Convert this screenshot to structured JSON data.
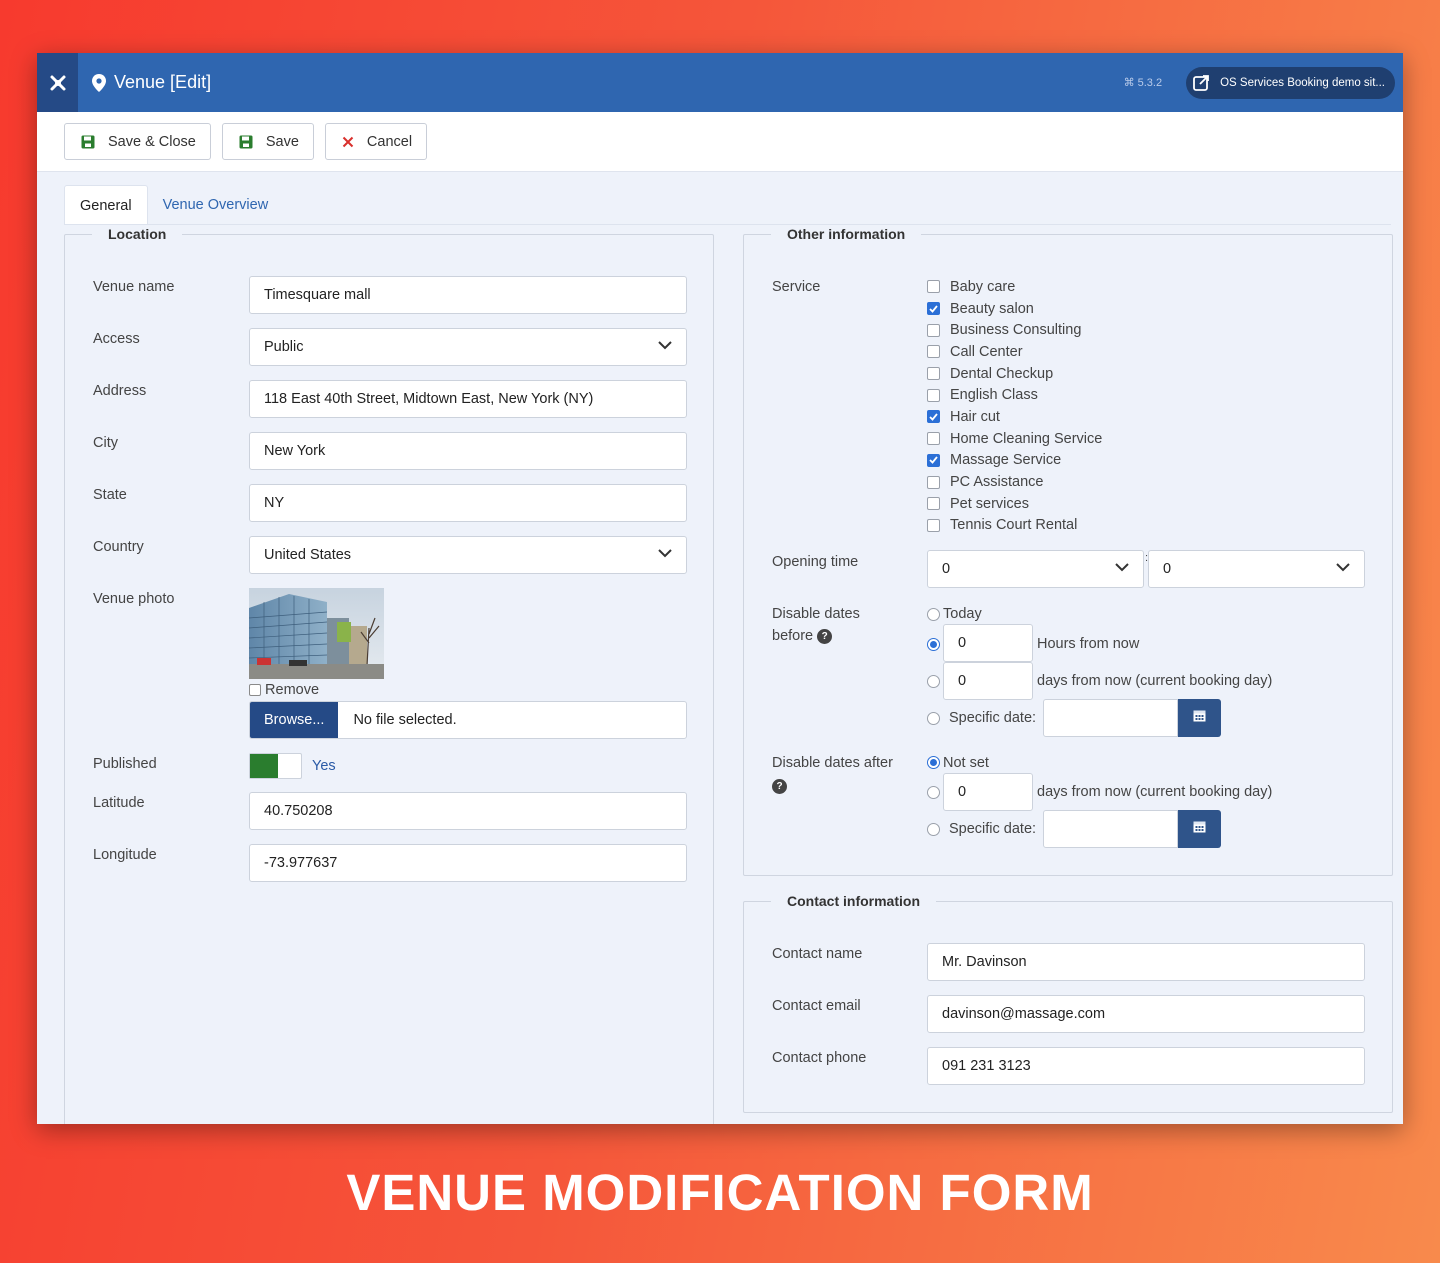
{
  "topbar": {
    "title": "Venue [Edit]",
    "version": "5.3.2",
    "site_link": "OS Services Booking demo sit..."
  },
  "toolbar": {
    "save_close": "Save & Close",
    "save": "Save",
    "cancel": "Cancel"
  },
  "tabs": [
    "General",
    "Venue Overview"
  ],
  "location": {
    "legend": "Location",
    "venue_name_label": "Venue name",
    "venue_name": "Timesquare mall",
    "access_label": "Access",
    "access": "Public",
    "address_label": "Address",
    "address": "118 East 40th Street, Midtown East, New York (NY)",
    "city_label": "City",
    "city": "New York",
    "state_label": "State",
    "state": "NY",
    "country_label": "Country",
    "country": "United States",
    "photo_label": "Venue photo",
    "remove_label": "Remove",
    "browse_label": "Browse...",
    "file_text": "No file selected.",
    "published_label": "Published",
    "published_value": "Yes",
    "latitude_label": "Latitude",
    "latitude": "40.750208",
    "longitude_label": "Longitude",
    "longitude": "-73.977637"
  },
  "other": {
    "legend": "Other information",
    "service_label": "Service",
    "services": [
      {
        "label": "Baby care",
        "checked": false
      },
      {
        "label": "Beauty salon",
        "checked": true
      },
      {
        "label": "Business Consulting",
        "checked": false
      },
      {
        "label": "Call Center",
        "checked": false
      },
      {
        "label": "Dental Checkup",
        "checked": false
      },
      {
        "label": "English Class",
        "checked": false
      },
      {
        "label": "Hair cut",
        "checked": true
      },
      {
        "label": "Home Cleaning Service",
        "checked": false
      },
      {
        "label": "Massage Service",
        "checked": true
      },
      {
        "label": "PC Assistance",
        "checked": false
      },
      {
        "label": "Pet services",
        "checked": false
      },
      {
        "label": "Tennis Court Rental",
        "checked": false
      }
    ],
    "opening_label": "Opening time",
    "opening_hour": "0",
    "opening_minute": "0",
    "opening_sep": ":",
    "disable_before_label_1": "Disable dates",
    "disable_before_label_2": "before",
    "today_label": "Today",
    "hours_value": "0",
    "hours_label": "Hours from now",
    "days_value": "0",
    "days_label": "days from now (current booking day)",
    "specific_label": "Specific date:",
    "disable_after_label": "Disable dates after",
    "not_set_label": "Not set",
    "after_days_value": "0",
    "after_days_label": "days from now (current booking day)",
    "after_specific_label": "Specific date:"
  },
  "contact": {
    "legend": "Contact information",
    "name_label": "Contact name",
    "name": "Mr. Davinson",
    "email_label": "Contact email",
    "email": "davinson@massage.com",
    "phone_label": "Contact phone",
    "phone": "091 231 3123"
  },
  "caption": "VENUE MODIFICATION FORM",
  "colors": {
    "header": "#2f66b0",
    "header_dark": "#254a86",
    "accent": "#2b6fd6",
    "toggle_on": "#2a7d2e",
    "save_icon": "#2a7d2e",
    "cancel_icon": "#d9302c"
  }
}
